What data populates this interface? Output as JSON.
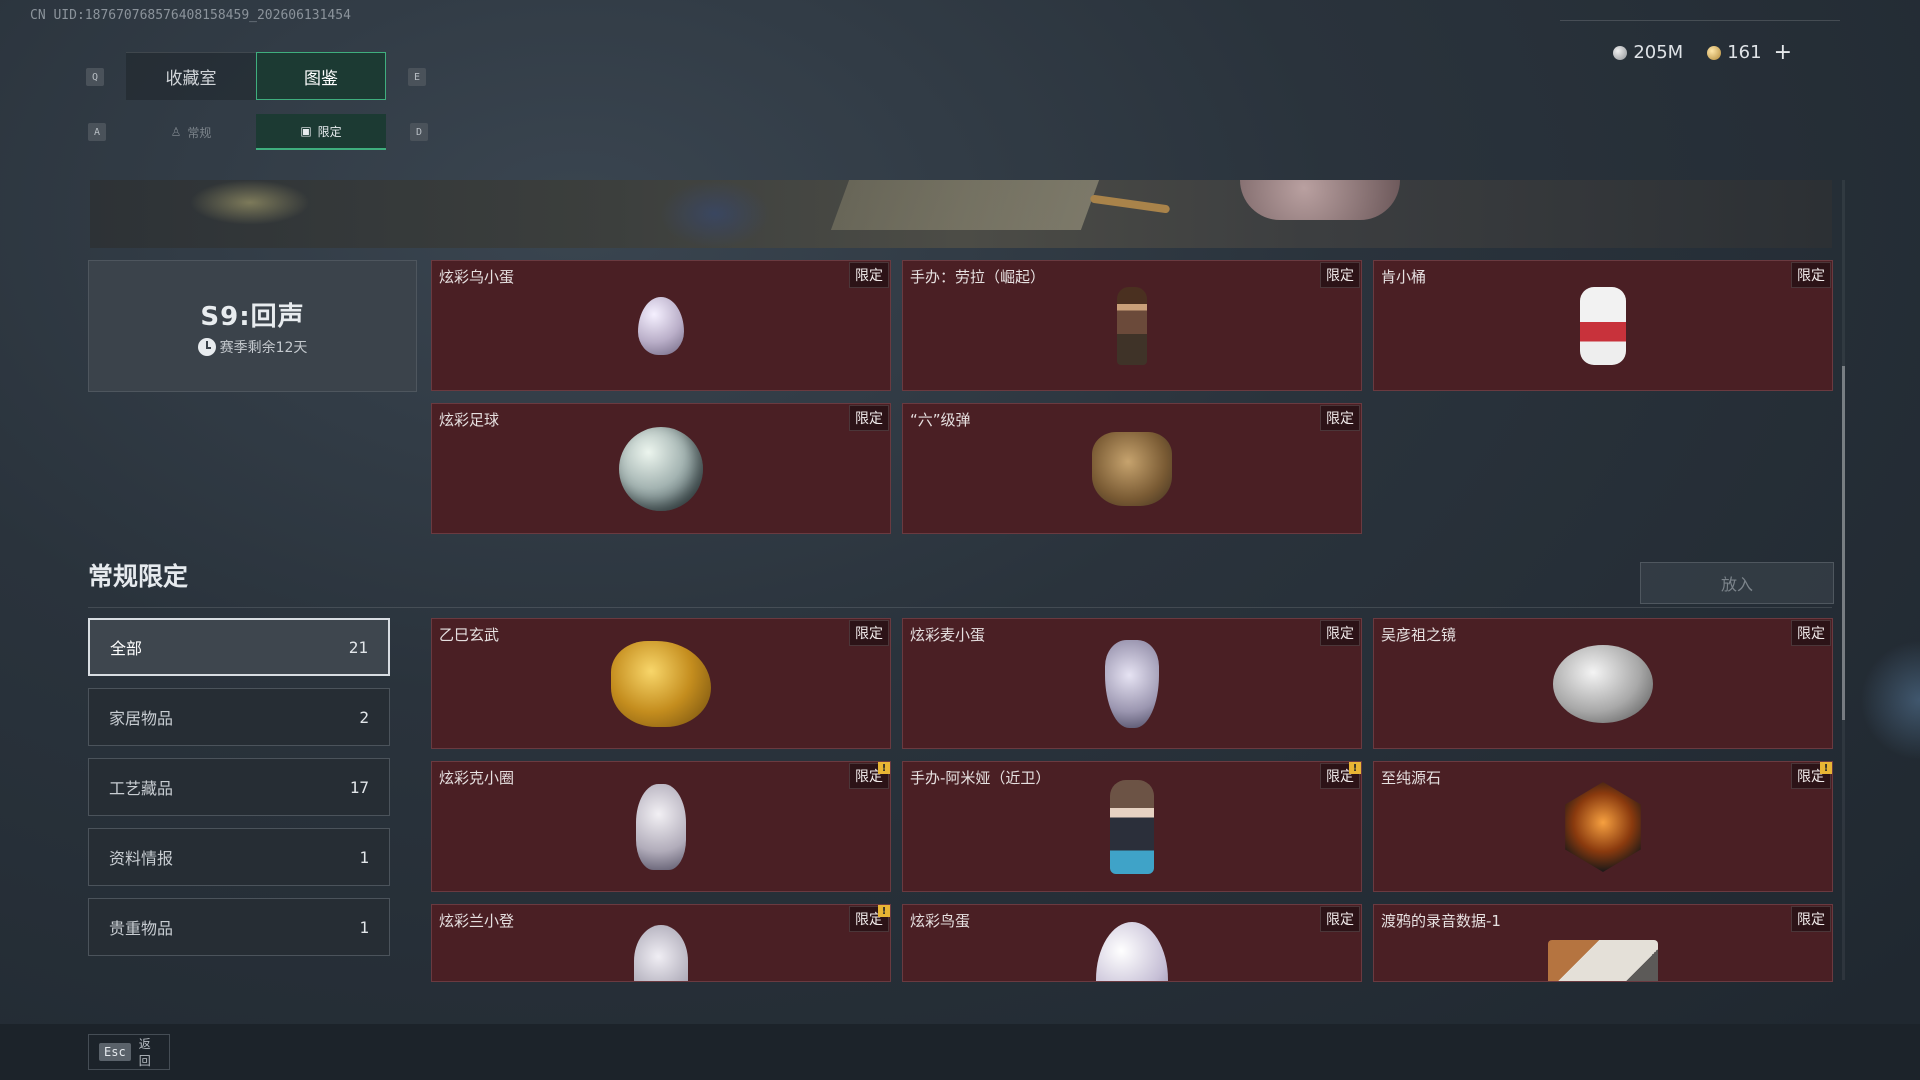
{
  "uid": "CN UID:187670768576408158459_202606131454",
  "currency": [
    {
      "icon": "silver-coin-icon",
      "value": "205M"
    },
    {
      "icon": "gold-coin-icon",
      "value": "161"
    }
  ],
  "currency_plus": "+",
  "keys": {
    "q": "Q",
    "e": "E",
    "a": "A",
    "d": "D"
  },
  "main_tabs": [
    {
      "label": "收藏室",
      "active": false
    },
    {
      "label": "图鉴",
      "active": true
    }
  ],
  "sub_tabs": [
    {
      "label": "常规",
      "icon": "figure-icon",
      "active": false
    },
    {
      "label": "限定",
      "icon": "image-icon",
      "active": true
    }
  ],
  "season": {
    "title": "S9:回声",
    "remaining": "赛季剩余12天"
  },
  "season_items": [
    {
      "name": "炫彩乌小蛋",
      "badge": "限定"
    },
    {
      "name": "手办：劳拉（崛起）",
      "badge": "限定"
    },
    {
      "name": "肯小桶",
      "badge": "限定"
    },
    {
      "name": "炫彩足球",
      "badge": "限定"
    },
    {
      "name": "“六”级弹",
      "badge": "限定"
    }
  ],
  "section": {
    "title": "常规限定",
    "put_button": "放入"
  },
  "categories": [
    {
      "label": "全部",
      "count": "21"
    },
    {
      "label": "家居物品",
      "count": "2"
    },
    {
      "label": "工艺藏品",
      "count": "17"
    },
    {
      "label": "资料情报",
      "count": "1"
    },
    {
      "label": "贵重物品",
      "count": "1"
    }
  ],
  "regular_items": [
    {
      "name": "乙巳玄武",
      "badge": "限定",
      "new": false
    },
    {
      "name": "炫彩麦小蛋",
      "badge": "限定",
      "new": false
    },
    {
      "name": "吴彦祖之镜",
      "badge": "限定",
      "new": false
    },
    {
      "name": "炫彩克小圈",
      "badge": "限定",
      "new": true
    },
    {
      "name": "手办-阿米娅（近卫）",
      "badge": "限定",
      "new": true
    },
    {
      "name": "至纯源石",
      "badge": "限定",
      "new": true
    },
    {
      "name": "炫彩兰小登",
      "badge": "限定",
      "new": true
    },
    {
      "name": "炫彩鸟蛋",
      "badge": "限定",
      "new": false
    },
    {
      "name": "渡鸦的录音数据-1",
      "badge": "限定",
      "new": false
    }
  ],
  "new_mark": "!",
  "footer": {
    "key": "Esc",
    "label": "返回"
  }
}
